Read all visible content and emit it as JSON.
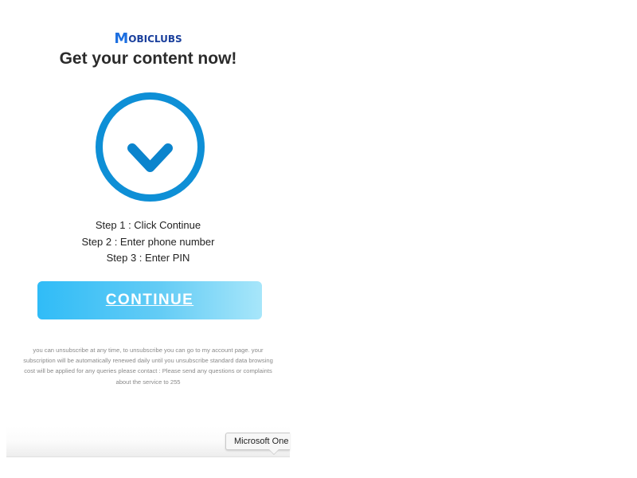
{
  "brand": {
    "logo_mark": "M",
    "logo_text": "OBICLUBS",
    "color": "#1a4fb8"
  },
  "headline": "Get your content now!",
  "download_graphic": {
    "icon": "download-arrow-icon",
    "color": "#0e8fd6"
  },
  "steps": [
    "Step 1 : Click Continue",
    "Step 2 : Enter phone number",
    "Step 3 : Enter PIN"
  ],
  "continue_button": {
    "label": "CONTINUE",
    "color_start": "#30bcf7",
    "color_end": "#a7e6fa"
  },
  "legal_text": "you can unsubscribe at any time, to unsubscribe you can go to my account page. your subscription will be automatically renewed daily until you unsubscribe standard data browsing cost will be applied for any queries please contact : Please send any questions or complaints about the service to 255",
  "tooltip": {
    "text": "Microsoft One"
  }
}
